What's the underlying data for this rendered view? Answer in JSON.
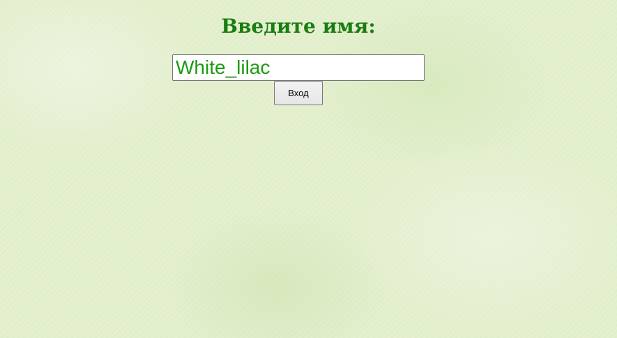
{
  "login": {
    "title": "Введите имя:",
    "name_value": "White_lilac",
    "submit_label": "Вход"
  },
  "colors": {
    "background": "#e3efcd",
    "title": "#1a7d12",
    "input_text": "#1c9a12"
  }
}
